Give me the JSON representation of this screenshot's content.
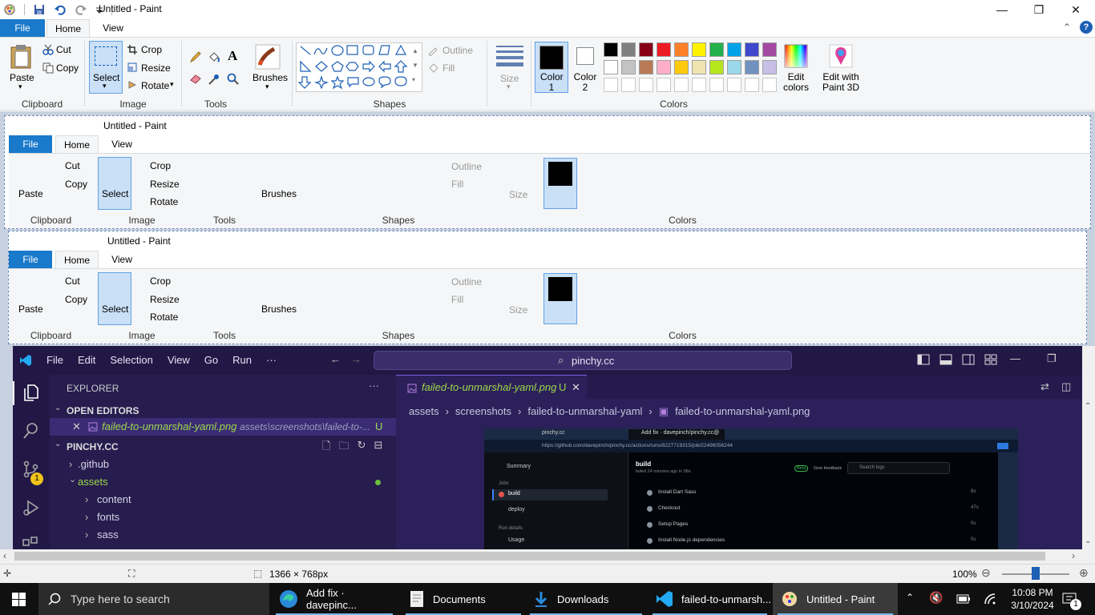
{
  "window": {
    "title": "Untitled - Paint"
  },
  "tabs": {
    "file": "File",
    "home": "Home",
    "view": "View"
  },
  "clipboard": {
    "paste": "Paste",
    "cut": "Cut",
    "copy": "Copy",
    "group": "Clipboard"
  },
  "image": {
    "select": "Select",
    "crop": "Crop",
    "resize": "Resize",
    "rotate": "Rotate",
    "group": "Image"
  },
  "tools": {
    "group": "Tools",
    "brushes": "Brushes"
  },
  "shapes": {
    "outline": "Outline",
    "fill": "Fill",
    "group": "Shapes",
    "size": "Size"
  },
  "colors": {
    "color1": "Color 1",
    "color2": "Color 2",
    "edit": "Edit colors",
    "paint3d": "Edit with Paint 3D",
    "group": "Colors",
    "palette_row1": [
      "#000000",
      "#7f7f7f",
      "#880015",
      "#ed1c24",
      "#ff7f27",
      "#fff200",
      "#22b14c",
      "#00a2e8",
      "#3f48cc",
      "#a349a4"
    ],
    "palette_row2": [
      "#ffffff",
      "#c3c3c3",
      "#b97a57",
      "#ffaec9",
      "#ffc90e",
      "#efe4b0",
      "#b5e61d",
      "#99d9ea",
      "#7092be",
      "#c8bfe7"
    ]
  },
  "vscode": {
    "menu": [
      "File",
      "Edit",
      "Selection",
      "View",
      "Go",
      "Run",
      "···"
    ],
    "search": "pinchy.cc",
    "explorer": "EXPLORER",
    "open_editors": "OPEN EDITORS",
    "open_file": "failed-to-unmarshal-yaml.png",
    "open_file_path": "assets\\screenshots\\failed-to-...",
    "open_file_badge": "U",
    "project": "PINCHY.CC",
    "tree": [
      ".github",
      "assets",
      "content",
      "fonts",
      "sass"
    ],
    "tab_name": "failed-to-unmarshal-yaml.png",
    "tab_badge": "U",
    "breadcrumbs": [
      "assets",
      "screenshots",
      "failed-to-unmarshal-yaml",
      "failed-to-unmarshal-yaml.png"
    ],
    "scm_badge": "1"
  },
  "inner_browser": {
    "tab1": "pinchy.cc",
    "tab2": "Add fix · davepinch/pinchy.cc@",
    "url": "https://github.com/davepinch/pinchy.cc/actions/runs/8227719315/job/22496056244",
    "summary": "Summary",
    "jobs_label": "Jobs",
    "job_build": "build",
    "job_deploy": "deploy",
    "run_details": "Run details",
    "usage": "Usage",
    "build_title": "build",
    "build_sub": "failed 24 minutes ago in 58s",
    "beta": "Beta",
    "feedback": "Give feedback",
    "search_logs": "Search logs",
    "steps": [
      "Install Dart Sass",
      "Checkout",
      "Setup Pages",
      "Install Node.js dependencies"
    ],
    "step_times": [
      "8s",
      "47s",
      "0s",
      "0s"
    ]
  },
  "status": {
    "dimensions": "1366 × 768px",
    "zoom": "100%"
  },
  "taskbar": {
    "search_placeholder": "Type here to search",
    "items": [
      "Add fix · davepinc...",
      "Documents",
      "Downloads",
      "failed-to-unmarsh...",
      "Untitled - Paint"
    ],
    "time": "10:08 PM",
    "date": "3/10/2024",
    "notif_count": "1"
  }
}
